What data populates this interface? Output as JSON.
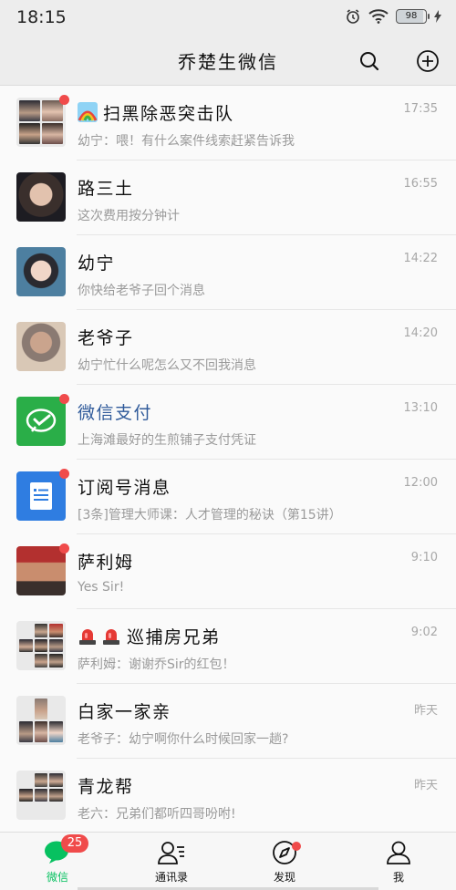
{
  "status_bar": {
    "time": "18:15",
    "battery": "98"
  },
  "header": {
    "title": "乔楚生微信"
  },
  "chats": [
    {
      "name": "扫黑除恶突击队",
      "message": "幼宁：喂！有什么案件线索赶紧告诉我",
      "time": "17:35",
      "unread_dot": true,
      "name_prefix_icon": "rainbow-icon"
    },
    {
      "name": "路三土",
      "message": "这次费用按分钟计",
      "time": "16:55",
      "unread_dot": false
    },
    {
      "name": "幼宁",
      "message": "你快给老爷子回个消息",
      "time": "14:22",
      "unread_dot": false
    },
    {
      "name": "老爷子",
      "message": "幼宁忙什么呢怎么又不回我消息",
      "time": "14:20",
      "unread_dot": false
    },
    {
      "name": "微信支付",
      "message": "上海滩最好的生煎铺子支付凭证",
      "time": "13:10",
      "unread_dot": true,
      "name_color": "#2f5a9a"
    },
    {
      "name": "订阅号消息",
      "message": "[3条]管理大师课：人才管理的秘诀（第15讲）",
      "time": "12:00",
      "unread_dot": true
    },
    {
      "name": "萨利姆",
      "message": "Yes Sir!",
      "time": "9:10",
      "unread_dot": true
    },
    {
      "name": "巡捕房兄弟",
      "message": "萨利姆：谢谢乔Sir的红包！",
      "time": "9:02",
      "unread_dot": false,
      "name_prefix_icon": "siren-icon"
    },
    {
      "name": "白家一家亲",
      "message": "老爷子：幼宁啊你什么时候回家一趟?",
      "time": "昨天",
      "unread_dot": false
    },
    {
      "name": "青龙帮",
      "message": "老六：兄弟们都听四哥吩咐!",
      "time": "昨天",
      "unread_dot": false
    }
  ],
  "tabs": [
    {
      "label": "微信",
      "badge": "25",
      "active": true,
      "icon": "chat-bubble-icon"
    },
    {
      "label": "通讯录",
      "active": false,
      "icon": "contacts-icon"
    },
    {
      "label": "发现",
      "active": false,
      "dot": true,
      "icon": "compass-icon"
    },
    {
      "label": "我",
      "active": false,
      "icon": "person-icon"
    }
  ],
  "colors": {
    "accent": "#07c160",
    "badge": "#f04b4b",
    "pay_green": "#2aae48",
    "subscription_blue": "#2f7de1"
  }
}
